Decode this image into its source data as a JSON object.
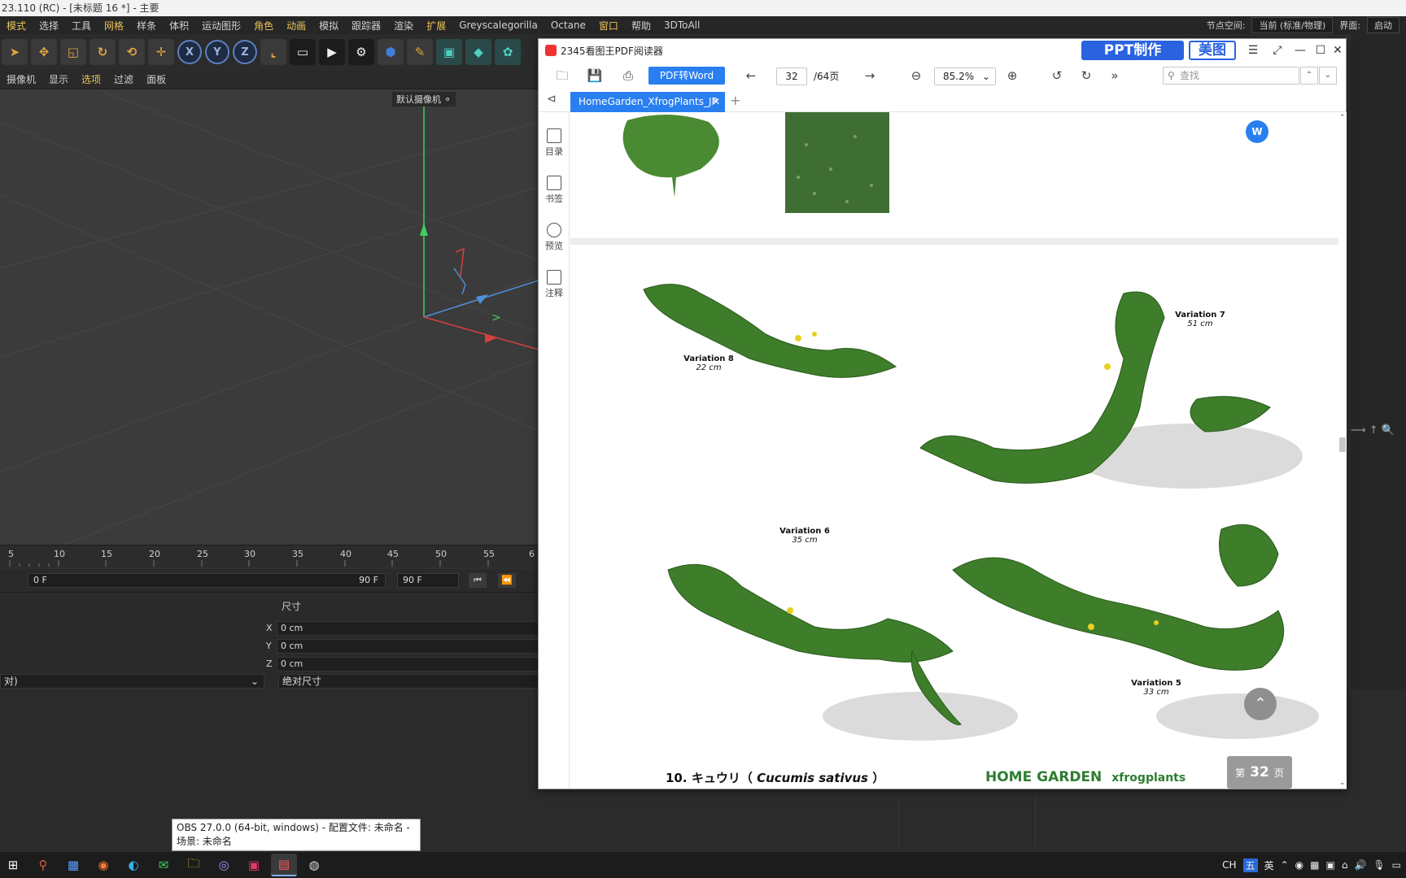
{
  "c4d": {
    "title": "23.110 (RC) - [未标题 16 *] - 主要",
    "menu": [
      "模式",
      "选择",
      "工具",
      "网格",
      "样条",
      "体积",
      "运动图形",
      "角色",
      "动画",
      "模拟",
      "跟踪器",
      "渲染",
      "扩展",
      "Greyscalegorilla",
      "Octane",
      "窗口",
      "帮助",
      "3DToAll"
    ],
    "node_space_label": "节点空间:",
    "node_space_value": "当前 (标准/物理)",
    "interface_label": "界面:",
    "interface_value": "启动",
    "toolbar_axes": [
      "X",
      "Y",
      "Z"
    ],
    "subbar": [
      "摄像机",
      "显示",
      "选项",
      "过滤",
      "面板"
    ],
    "camera_label": "默认摄像机",
    "timeline_ticks": [
      "5",
      "10",
      "15",
      "20",
      "25",
      "30",
      "35",
      "40",
      "45",
      "50",
      "55",
      "6"
    ],
    "frame_start": "0 F",
    "frame_end": "90 F",
    "frame_end_field": "90 F",
    "size_header": "尺寸",
    "axes": [
      {
        "axis": "X",
        "value": "0 cm"
      },
      {
        "axis": "Y",
        "value": "0 cm"
      },
      {
        "axis": "Z",
        "value": "0 cm"
      }
    ],
    "mode_left": "对)",
    "mode_right": "绝对尺寸"
  },
  "pdf": {
    "app_title": "2345看图王PDF阅读器",
    "ppt_button": "PPT制作",
    "meitu_button": "美图",
    "pdf_to_word": "PDF转Word",
    "page_current": "32",
    "page_total": "/64页",
    "zoom": "85.2%",
    "search_placeholder": "查找",
    "tab_name": "HomeGarden_XfrogPlants_JP",
    "sidebar": [
      "目录",
      "书签",
      "预览",
      "注释"
    ],
    "variations": [
      {
        "name": "Variation 8",
        "size": "22 cm"
      },
      {
        "name": "Variation 7",
        "size": "51 cm"
      },
      {
        "name": "Variation 6",
        "size": "35 cm"
      },
      {
        "name": "Variation 5",
        "size": "33 cm"
      }
    ],
    "caption_prefix": "10.",
    "caption_jp": "キュウリ（",
    "caption_latin": "Cucumis sativus",
    "caption_suffix": "）",
    "brand": "HOME GARDEN",
    "brand_small": "xfrogplants",
    "page_badge_pre": "第",
    "page_badge_num": "32",
    "page_badge_post": "页",
    "word_float": "W"
  },
  "obs_tooltip": "OBS 27.0.0 (64-bit, windows) - 配置文件: 未命名 - 场景: 未命名",
  "tray": {
    "lang": "CH",
    "ime1": "五",
    "ime2": "英"
  },
  "colors": {
    "accent_blue": "#2a7ff0",
    "ppt_blue": "#2a62e0",
    "brand_green": "#2e7d32",
    "c4d_highlight": "#e8c35a"
  }
}
